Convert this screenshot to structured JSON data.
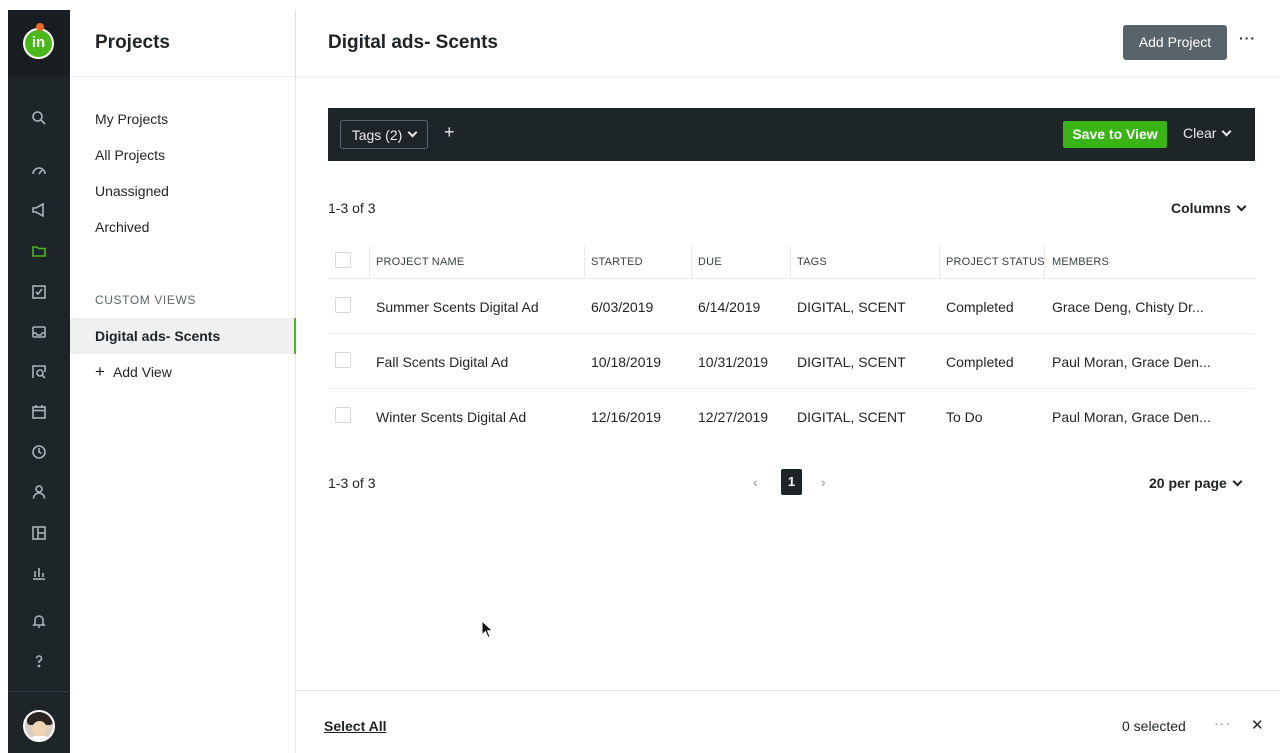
{
  "rail": {
    "logo_text": "in",
    "icons": [
      "search-icon",
      "dashboard-icon",
      "megaphone-icon",
      "folder-icon",
      "task-check-icon",
      "inbox-icon",
      "proof-search-icon",
      "calendar-icon",
      "clock-icon",
      "user-icon",
      "layout-icon",
      "reports-chart-icon",
      "bell-icon",
      "help-icon"
    ],
    "accent_color": "#4cb71a"
  },
  "panel": {
    "title": "Projects",
    "nav": [
      "My Projects",
      "All Projects",
      "Unassigned",
      "Archived"
    ],
    "custom_views_label": "CUSTOM VIEWS",
    "active_view": "Digital ads- Scents",
    "add_view": "Add View"
  },
  "header": {
    "title": "Digital ads- Scents",
    "add_project": "Add Project",
    "more": "···"
  },
  "filter_bar": {
    "tags_label": "Tags (2)",
    "add": "+",
    "save_to_view": "Save to View",
    "clear": "Clear"
  },
  "summary": {
    "count_top": "1-3 of 3",
    "columns": "Columns",
    "count_bottom": "1-3 of 3",
    "page_prev": "‹",
    "current_page": "1",
    "page_next": "›",
    "per_page": "20 per page"
  },
  "table": {
    "headers": [
      "PROJECT NAME",
      "STARTED",
      "DUE",
      "TAGS",
      "PROJECT STATUS",
      "MEMBERS"
    ],
    "rows": [
      {
        "name": "Summer Scents Digital Ad",
        "started": "6/03/2019",
        "due": "6/14/2019",
        "tags": "DIGITAL, SCENT",
        "status": "Completed",
        "members": "Grace Deng, Chisty Dr..."
      },
      {
        "name": "Fall Scents Digital Ad",
        "started": "10/18/2019",
        "due": "10/31/2019",
        "tags": "DIGITAL, SCENT",
        "status": "Completed",
        "members": "Paul Moran, Grace Den..."
      },
      {
        "name": "Winter Scents Digital Ad",
        "started": "12/16/2019",
        "due": "12/27/2019",
        "tags": "DIGITAL, SCENT",
        "status": "To Do",
        "members": "Paul Moran, Grace Den..."
      }
    ]
  },
  "footer": {
    "select_all": "Select All",
    "selected": "0 selected",
    "more": "···",
    "close": "✕"
  }
}
